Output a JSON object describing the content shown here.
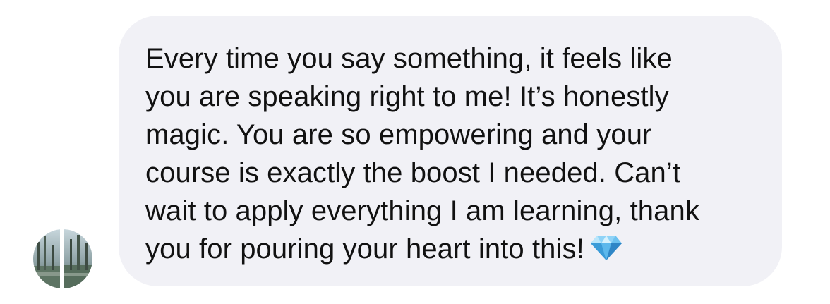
{
  "message": {
    "text": "Every time you say something, it feels like\nyou are speaking right to me! It’s honestly\nmagic. You are so empowering and your\ncourse is exactly the boost I needed. Can’t\nwait to apply everything I am learning, thank\nyou for pouring your heart into this!",
    "emoji": "gem-stone-icon",
    "bubble_color": "#f1f1f6",
    "text_color": "#111111"
  },
  "sender": {
    "avatar": "contact-avatar"
  }
}
